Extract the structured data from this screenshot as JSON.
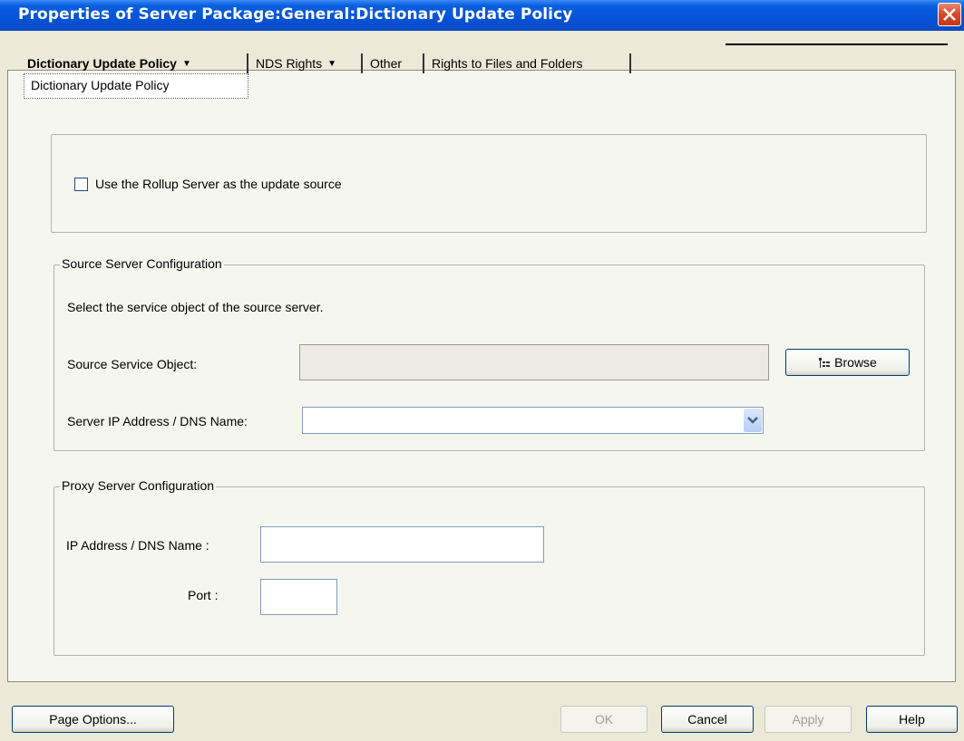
{
  "window": {
    "title": "Properties of Server Package:General:Dictionary Update Policy"
  },
  "tabs": [
    {
      "label": "Dictionary Update Policy",
      "active": true,
      "has_dropdown": true
    },
    {
      "label": "NDS Rights",
      "active": false,
      "has_dropdown": true
    },
    {
      "label": "Other",
      "active": false,
      "has_dropdown": false
    },
    {
      "label": "Rights to Files and Folders",
      "active": false,
      "has_dropdown": false
    }
  ],
  "tab_dropdown": {
    "items": [
      "Dictionary Update Policy"
    ]
  },
  "rollup": {
    "checkbox_label": "Use the Rollup Server as the update source",
    "checked": false
  },
  "source_config": {
    "legend": "Source Server Configuration",
    "instruction": "Select the service object of the source server.",
    "service_object_label": "Source Service Object:",
    "service_object_value": "",
    "browse_label": "Browse",
    "ip_label": "Server IP Address / DNS Name:",
    "ip_value": ""
  },
  "proxy_config": {
    "legend": "Proxy Server Configuration",
    "ip_label": "IP Address / DNS Name :",
    "ip_value": "",
    "port_label": "Port :",
    "port_value": ""
  },
  "buttons": {
    "page_options": "Page Options...",
    "ok": "OK",
    "cancel": "Cancel",
    "apply": "Apply",
    "help": "Help"
  },
  "icons": {
    "close": "close-icon",
    "tab_caret": "chevron-down-icon",
    "dropdown": "chevron-down-icon",
    "browse": "tree-browse-icon"
  },
  "colors": {
    "titlebar": "#0553d6",
    "dialog_bg": "#ece9d8",
    "panel_bg": "#f6f6f1"
  }
}
